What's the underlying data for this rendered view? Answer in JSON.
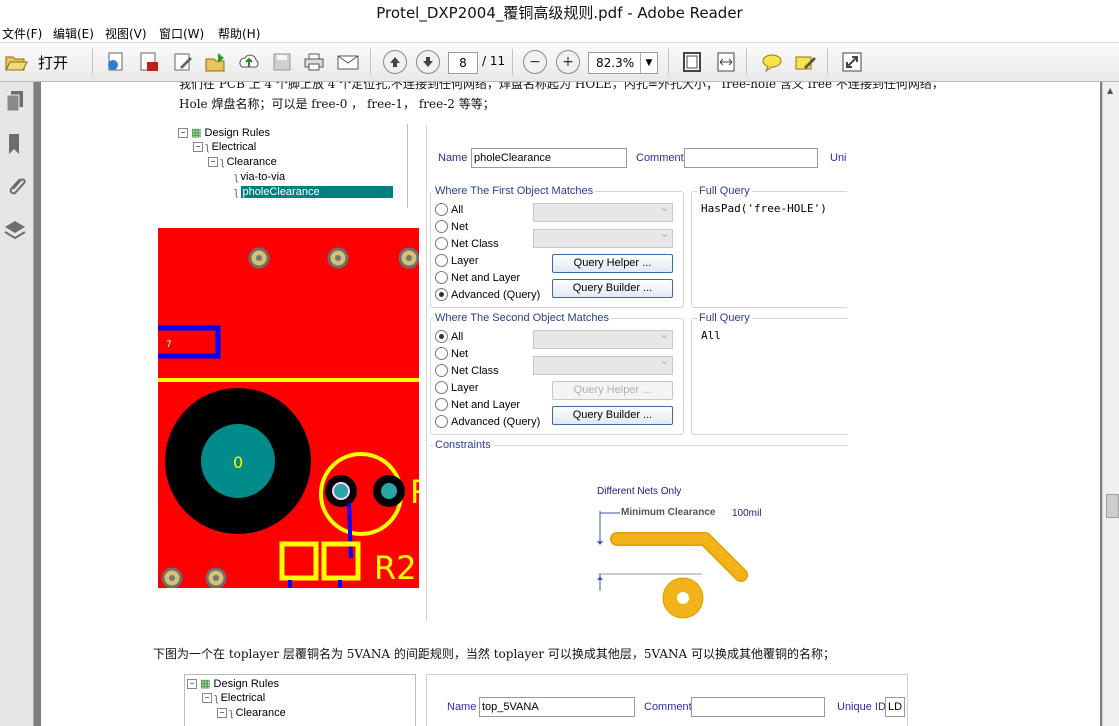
{
  "window": {
    "title": "Protel_DXP2004_覆铜高级规则.pdf - Adobe Reader"
  },
  "menu": [
    "文件(F)",
    "编辑(E)",
    "视图(V)",
    "窗口(W)",
    "帮助(H)"
  ],
  "toolbar": {
    "open_label": "打开",
    "page_current": "8",
    "page_total": "/ 11",
    "zoom": "82.3%",
    "icons": [
      "folder-open-icon",
      "export-icon",
      "create-pdf-icon",
      "edit-icon",
      "send-icon",
      "upload-icon",
      "save-icon",
      "print-icon",
      "email-icon",
      "prev-page-icon",
      "next-page-icon",
      "zoom-out-icon",
      "zoom-in-icon",
      "fit-page-icon",
      "fit-width-icon",
      "comment-icon",
      "sign-icon",
      "expand-icon"
    ]
  },
  "doc": {
    "para1_line1": "我们在 PCB 上 4 个脚上放 4 个定位孔,不连接到任何网络，焊盘名称起为 HOLE，内孔=外孔大小； free-hole 含义 free 不连接到任何网络，",
    "para1_line2": "Hole 焊盘名称；可以是 free-0 ， free-1， free-2 等等；",
    "para2": "下图为一个在 toplayer 层覆铜名为 5VANA 的间距规则，当然 toplayer 可以换成其他层，5VANA 可以换成其他覆铜的名称；",
    "tree1": [
      "Design Rules",
      "Electrical",
      "Clearance",
      "via-to-via",
      "pholeClearance"
    ],
    "tree2": [
      "Design Rules",
      "Electrical",
      "Clearance"
    ],
    "rule1": {
      "name_label": "Name",
      "name_value": "pholeClearance",
      "comment_label": "Comment",
      "unique_label": "Uni",
      "first_group": "Where The First Object Matches",
      "second_group": "Where The Second Object Matches",
      "full_query_label": "Full Query",
      "first_query": "HasPad('free-HOLE')",
      "second_query": "All",
      "options": [
        "All",
        "Net",
        "Net Class",
        "Layer",
        "Net and Layer",
        "Advanced (Query)"
      ],
      "query_helper": "Query Helper ...",
      "query_builder": "Query Builder ...",
      "constraints_label": "Constraints",
      "diff_nets": "Different Nets Only",
      "min_clear": "Minimum Clearance",
      "clear_value": "100mil"
    },
    "rule2": {
      "name_label": "Name",
      "name_value": "top_5VANA",
      "comment_label": "Comment",
      "unique_label": "Unique ID",
      "unique_value": "LD"
    },
    "pcb": {
      "label_7": "7",
      "label_0": "0",
      "label_r2": "R2",
      "label_r": "R"
    }
  },
  "colors": {
    "pcb_red": "#ff0000",
    "pcb_yellow": "#ffff00",
    "pcb_blue": "#0000ff",
    "teal": "#008b8b",
    "copper": "#f2b21a"
  }
}
